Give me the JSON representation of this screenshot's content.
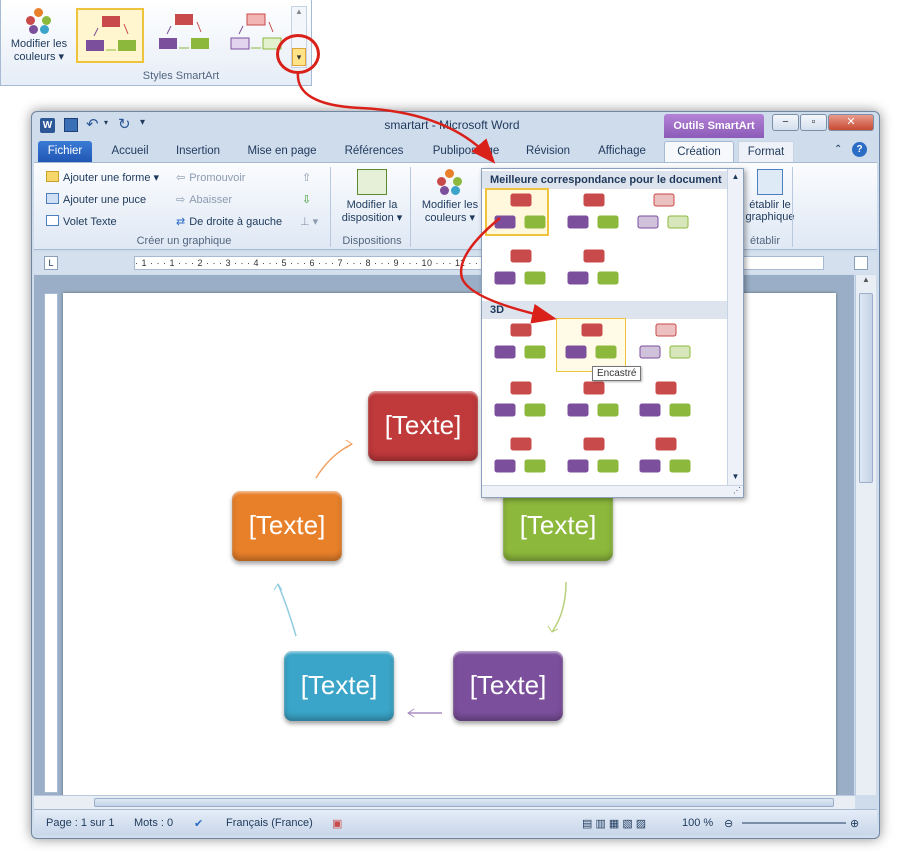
{
  "snippet": {
    "colors_label_1": "Modifier les",
    "colors_label_2": "couleurs",
    "group_label": "Styles SmartArt"
  },
  "window": {
    "title": "smartart - Microsoft Word",
    "contextual_tab": "Outils SmartArt",
    "controls": [
      "−",
      "▫",
      "✕"
    ]
  },
  "tabs": [
    "Fichier",
    "Accueil",
    "Insertion",
    "Mise en page",
    "Références",
    "Publipostage",
    "Révision",
    "Affichage",
    "Création",
    "Format"
  ],
  "ribbon": {
    "add_shape": "Ajouter une forme",
    "add_bullet": "Ajouter une puce",
    "text_pane": "Volet Texte",
    "promote": "Promouvoir",
    "demote": "Abaisser",
    "rtl": "De droite à gauche",
    "group_create": "Créer un graphique",
    "change_layout_1": "Modifier la",
    "change_layout_2": "disposition",
    "group_layouts": "Dispositions",
    "change_colors_1": "Modifier les",
    "change_colors_2": "couleurs",
    "reset_1": "établir le",
    "reset_2": "graphique",
    "group_reset": "établir"
  },
  "ruler": {
    "ticks": "· 1 · · · 1 · · · 2 · · · 3 · · · 4 · · · 5 · · · 6 · · · 7 · · · 8 · · · 9 · · · 10 · · · 11 · · · 12 · · · 13 · · · 14 · · · 15 · · · 16 · · · 17 · · · 18 ·"
  },
  "smartart": {
    "boxes": [
      {
        "label": "[Texte]",
        "color": "#c0393b"
      },
      {
        "label": "[Texte]",
        "color": "#8cb83c"
      },
      {
        "label": "[Texte]",
        "color": "#7b4f9c"
      },
      {
        "label": "[Texte]",
        "color": "#3aa5c8"
      },
      {
        "label": "[Texte]",
        "color": "#e8802a"
      }
    ]
  },
  "dropdown": {
    "header_best": "Meilleure correspondance pour le document",
    "header_3d": "3D",
    "tooltip": "Encastré"
  },
  "status": {
    "page": "Page : 1 sur 1",
    "words": "Mots : 0",
    "language": "Français (France)",
    "zoom": "100 %"
  },
  "colors": {
    "red": "#c84a4a",
    "green": "#8cb83c",
    "purple": "#7b4f9c",
    "accent_red": "#d9211a"
  }
}
